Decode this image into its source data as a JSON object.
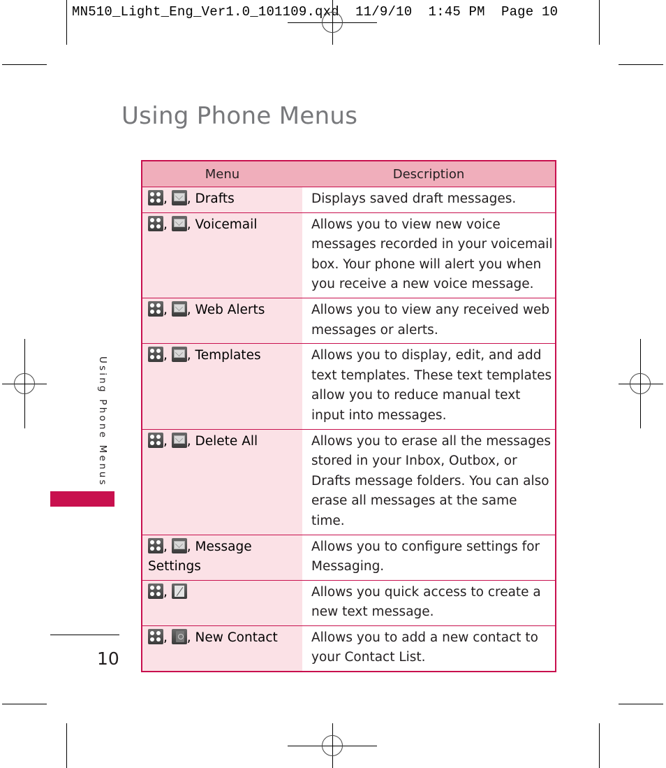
{
  "slug": {
    "filename": "MN510_Light_Eng_Ver1.0_101109.qxd",
    "date": "11/9/10",
    "time": "1:45 PM",
    "page_label": "Page 10"
  },
  "page": {
    "title": "Using Phone Menus",
    "side_label": "Using Phone Menus",
    "page_number": "10",
    "accent_color": "#c8104e"
  },
  "table": {
    "headers": {
      "menu": "Menu",
      "description": "Description"
    },
    "rows": [
      {
        "icons": [
          "menu-icon",
          "messaging-icon"
        ],
        "name": "Drafts",
        "description": "Displays saved draft messages."
      },
      {
        "icons": [
          "menu-icon",
          "messaging-icon"
        ],
        "name": "Voicemail",
        "description": "Allows you to view new voice messages recorded in your voicemail box. Your phone will alert you when you receive a new voice message."
      },
      {
        "icons": [
          "menu-icon",
          "messaging-icon"
        ],
        "name": "Web Alerts",
        "description": "Allows you to view any received web messages or alerts."
      },
      {
        "icons": [
          "menu-icon",
          "messaging-icon"
        ],
        "name": "Templates",
        "description": "Allows you to display, edit, and add text templates. These text templates allow you to reduce manual text input into messages."
      },
      {
        "icons": [
          "menu-icon",
          "messaging-icon"
        ],
        "name": "Delete All",
        "description": "Allows you to erase all the messages stored in your Inbox, Outbox, or Drafts message folders. You can also erase all messages at the same time."
      },
      {
        "icons": [
          "menu-icon",
          "messaging-icon"
        ],
        "name": "Message Settings",
        "description": "Allows you to configure settings for Messaging."
      },
      {
        "icons": [
          "menu-icon",
          "new-message-icon"
        ],
        "name": "",
        "description": "Allows you quick access to create a new text message."
      },
      {
        "icons": [
          "menu-icon",
          "contacts-icon"
        ],
        "name": "New Contact",
        "description": "Allows you to add a new contact to your Contact List."
      }
    ]
  }
}
